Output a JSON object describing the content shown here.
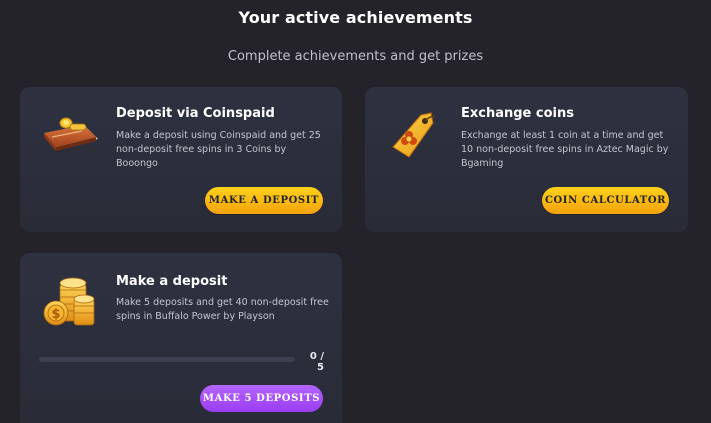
{
  "header": {
    "title": "Your active achievements",
    "subtitle": "Complete achievements and get prizes"
  },
  "achievements": [
    {
      "title": "Deposit via Coinspaid",
      "description": "Make a deposit using Coinspaid and get 25 non-deposit free spins in 3 Coins by Booongo",
      "button_label": "MAKE A DEPOSIT",
      "icon": "wallet-with-coin-icon"
    },
    {
      "title": "Exchange coins",
      "description": "Exchange at least 1 coin at a time and get 10 non-deposit free spins in Aztec Magic by Bgaming",
      "button_label": "COIN CALCULATOR",
      "icon": "price-tag-icon"
    },
    {
      "title": "Make a deposit",
      "description": "Make 5 deposits and get 40 non-deposit free spins in Buffalo Power by Playson",
      "button_label": "MAKE 5 DEPOSITS",
      "icon": "coin-stacks-icon",
      "progress": {
        "current": 0,
        "total": 5,
        "label": "0 / 5"
      }
    }
  ],
  "colors": {
    "background": "#232329",
    "card": "#2e3140",
    "button_yellow": "#ffc21a",
    "button_purple": "#a64bf4",
    "progress_track": "#3c4050"
  }
}
